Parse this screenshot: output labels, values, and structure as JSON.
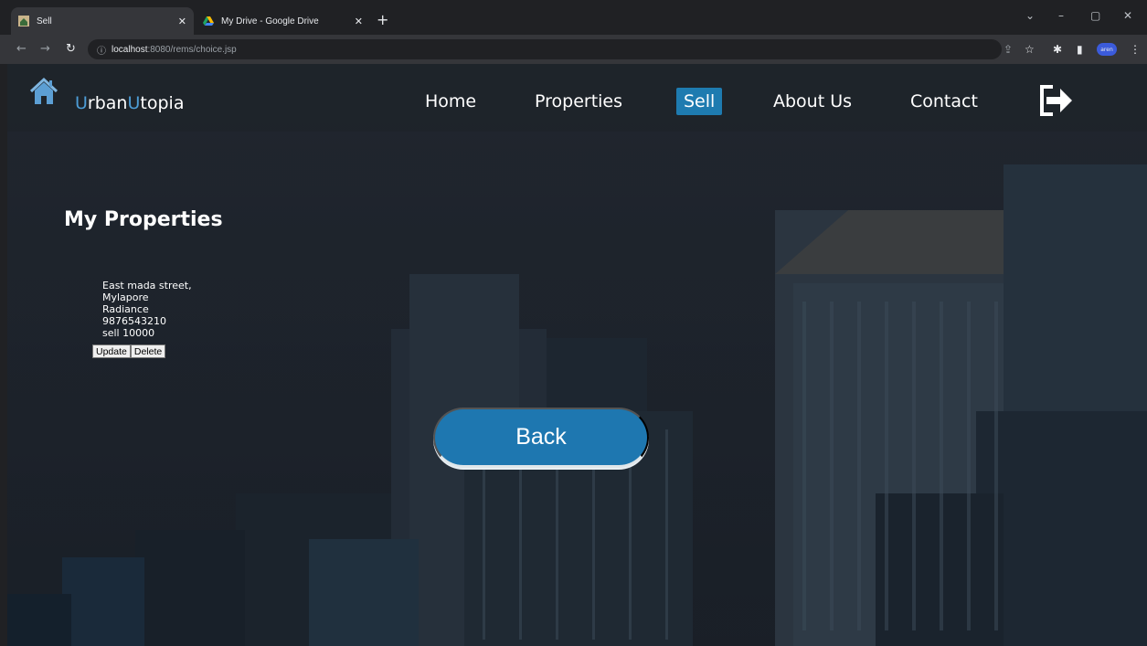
{
  "browser": {
    "tabs": [
      {
        "title": "Sell"
      },
      {
        "title": "My Drive - Google Drive"
      }
    ],
    "url_host": "localhost",
    "url_rest": ":8080/rems/choice.jsp",
    "info_icon": "info-icon",
    "profile_label": "aren"
  },
  "navbar": {
    "brand_first_initial": "U",
    "brand_first_rest": "rban",
    "brand_second_initial": "U",
    "brand_second_rest": "topia",
    "links": [
      {
        "label": "Home"
      },
      {
        "label": "Properties"
      },
      {
        "label": "Sell"
      },
      {
        "label": "About Us"
      },
      {
        "label": "Contact"
      }
    ],
    "active_link": "Sell",
    "accent_color": "#1e7bb0",
    "logout_icon": "logout-arrow-icon"
  },
  "main": {
    "heading": "My Properties",
    "property": {
      "lines": [
        "East mada street,",
        "Mylapore",
        "Radiance",
        "9876543210",
        "sell 10000"
      ],
      "update_label": "Update",
      "delete_label": "Delete"
    },
    "back_label": "Back"
  }
}
